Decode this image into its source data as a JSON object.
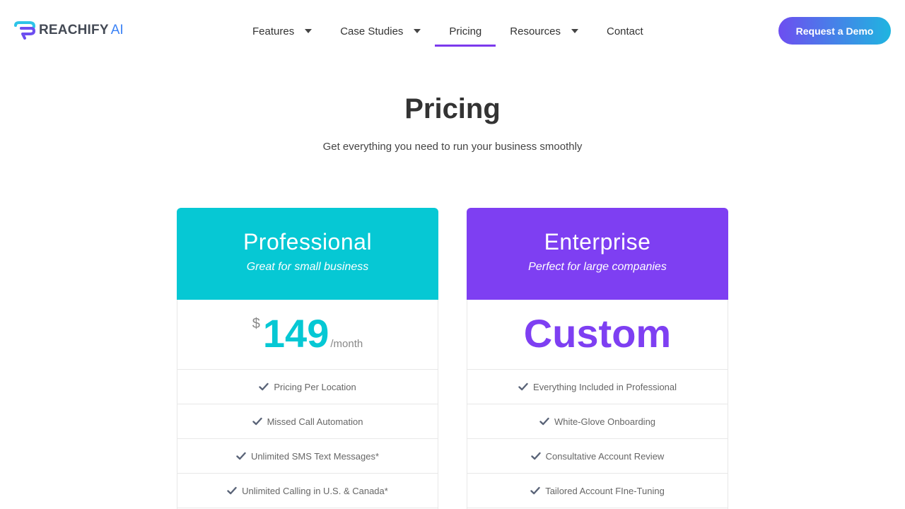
{
  "brand": {
    "name": "REACHIFY",
    "suffix": "AI"
  },
  "nav": {
    "items": [
      {
        "label": "Features",
        "dropdown": true
      },
      {
        "label": "Case Studies",
        "dropdown": true
      },
      {
        "label": "Pricing",
        "dropdown": false,
        "active": true
      },
      {
        "label": "Resources",
        "dropdown": true
      },
      {
        "label": "Contact",
        "dropdown": false
      }
    ]
  },
  "cta": {
    "label": "Request a Demo"
  },
  "hero": {
    "title": "Pricing",
    "subtitle": "Get everything you need to run your business smoothly"
  },
  "plans": [
    {
      "name": "Professional",
      "tagline": "Great for small business",
      "currency": "$",
      "amount": "149",
      "period": "/month",
      "color": "#06c8d4",
      "features": [
        "Pricing Per Location",
        "Missed Call Automation",
        "Unlimited SMS Text Messages*",
        "Unlimited Calling in U.S. & Canada*"
      ]
    },
    {
      "name": "Enterprise",
      "tagline": "Perfect for large companies",
      "price_label": "Custom",
      "color": "#7e3ff2",
      "features": [
        "Everything Included in Professional",
        "White-Glove Onboarding",
        "Consultative Account Review",
        "Tailored Account FIne-Tuning"
      ]
    }
  ],
  "colors": {
    "accent": "#7c3aed",
    "teal": "#06c8d4",
    "purple": "#7e3ff2",
    "check": "#5a6478"
  }
}
